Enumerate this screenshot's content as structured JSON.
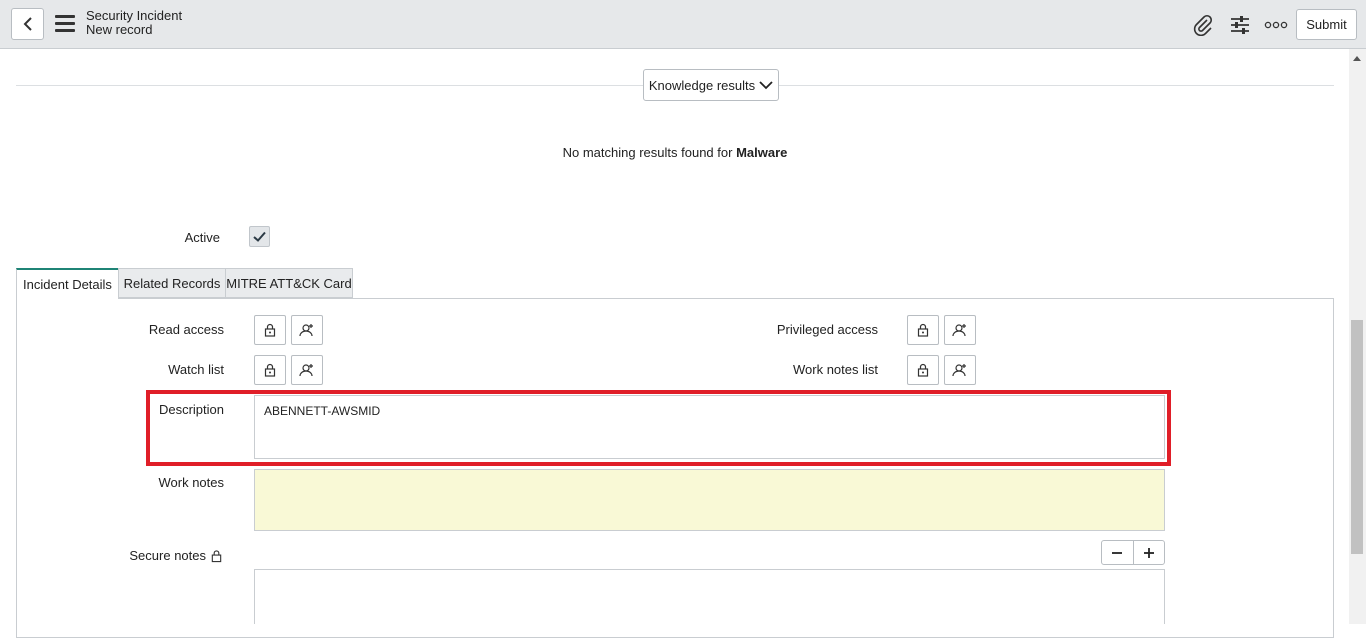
{
  "header": {
    "title": "Security Incident",
    "subtitle": "New record",
    "submit_label": "Submit",
    "icons": [
      "back-icon",
      "menu-icon",
      "paperclip-icon",
      "sliders-icon",
      "more-icon"
    ]
  },
  "knowledge": {
    "button_label": "Knowledge results",
    "no_match_prefix": "No matching results found for",
    "no_match_term": "Malware"
  },
  "form": {
    "active_label": "Active",
    "active_checked": true
  },
  "tabs": [
    {
      "label": "Incident Details",
      "active": true
    },
    {
      "label": "Related Records",
      "active": false
    },
    {
      "label": "MITRE ATT&CK Card",
      "active": false
    }
  ],
  "fields": {
    "read_access_label": "Read access",
    "watch_list_label": "Watch list",
    "privileged_access_label": "Privileged access",
    "work_notes_list_label": "Work notes list",
    "description_label": "Description",
    "description_value": "ABENNETT-AWSMID",
    "work_notes_label": "Work notes",
    "work_notes_value": "",
    "secure_notes_label": "Secure notes",
    "secure_notes_value": ""
  },
  "colors": {
    "accent": "#1f8476",
    "highlight": "#e01e28",
    "work_notes_bg": "#f9f9d6",
    "header_bg": "#e6e8ea"
  }
}
